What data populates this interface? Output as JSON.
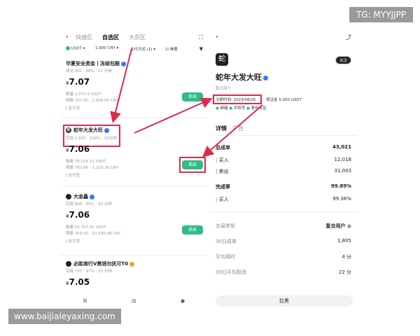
{
  "watermarks": {
    "top_right": "TG: MYYJJPP",
    "bottom_left": "www.baijialeyaxing.com"
  },
  "left": {
    "tabs": [
      "快捷区",
      "自选区",
      "大宗区"
    ],
    "filters": {
      "coin": "USDT",
      "amount": "1,000 CNY",
      "payment": "支付方式 (1)",
      "checkbox": "神盾"
    },
    "merchants": [
      {
        "avatar": "",
        "name": "华夏安全资金丨冻结包赔",
        "stats": "成交 302 · 98% · 20 分钟",
        "price": "7.07",
        "qty": "数量 1,072.9 USDT",
        "limit": "限额 707.00 - 2,928.00 CNY",
        "pay": "支付宝",
        "button": "卖出"
      },
      {
        "avatar": "蛇",
        "name": "蛇年大发大旺",
        "stats": "完成 1,905 · 100% · 20分钟",
        "price": "7.06",
        "qty": "数量 78,029.12 USDT",
        "limit": "限额 783.66 - 3,219.36 CNY",
        "pay": "支付宝",
        "button": "卖出"
      },
      {
        "avatar": "",
        "name": "大金鑫",
        "stats": "完成 898 · 99% · 20 分钟",
        "price": "7.06",
        "qty": "数量 50,707.81 USDT",
        "limit": "限额 353.00 - 23,530.98 CNY",
        "pay": "支付宝",
        "button": "卖出"
      },
      {
        "avatar": "",
        "name": "必胜商行V黑钱勿扰可T0",
        "stats": "完成 797 · 97% · 20 分钟",
        "price": "7.05",
        "qty": "",
        "limit": "",
        "pay": "",
        "button": ""
      }
    ]
  },
  "right": {
    "avatar_char": "蛇",
    "follow": "关注",
    "name": "蛇年大发大旺",
    "sub": "暂无简介",
    "registered": "注册时间: 2023/08/26",
    "deposit": "保证金 5,000 USDT",
    "verify": [
      "邮箱",
      "手机号",
      "身份认证"
    ],
    "tabs": [
      "详情",
      "广告"
    ],
    "total_orders_label": "总成单",
    "total_orders": "43,021",
    "buy_label": "买入",
    "buy": "12,018",
    "sell_label": "卖出",
    "sell": "31,003",
    "completion_label": "完成率",
    "completion": "99.89%",
    "completion_buy_label": "买入",
    "completion_buy": "99.36%",
    "trade_type_label": "交易类型",
    "trade_type": "复合用户",
    "orders30_label": "30日成单",
    "orders30": "1,805",
    "avg_time_label": "平均用时",
    "avg_time": "4 分",
    "cancel30_label": "30日平均取消",
    "cancel30": "22 分",
    "block_button": "拉黑"
  },
  "colors": {
    "green": "#2ebd85",
    "red": "#e0294a",
    "blue": "#2f7cf6"
  }
}
